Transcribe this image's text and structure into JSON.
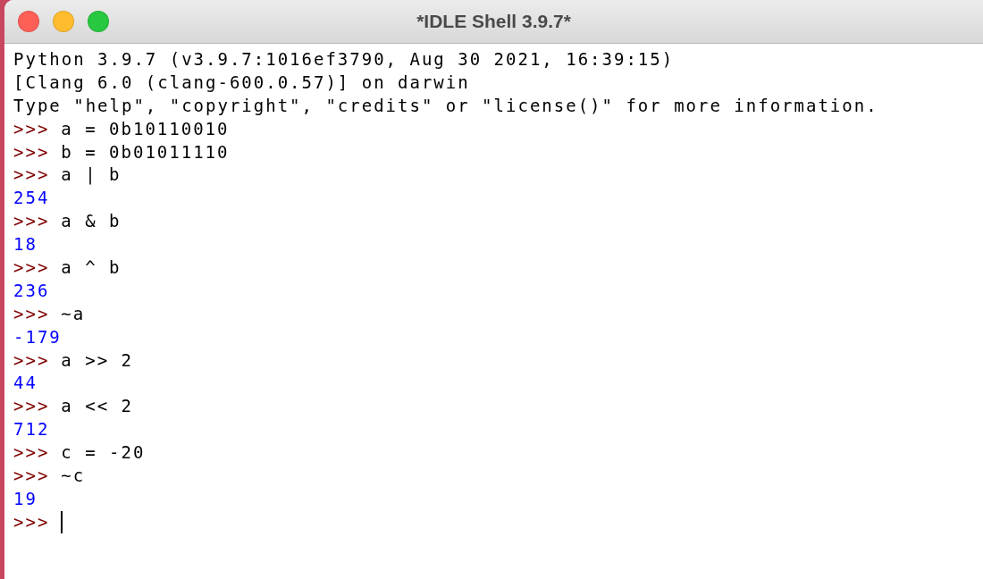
{
  "window": {
    "title": "*IDLE Shell 3.9.7*"
  },
  "shell": {
    "lines": [
      {
        "kind": "banner",
        "text": "Python 3.9.7 (v3.9.7:1016ef3790, Aug 30 2021, 16:39:15)"
      },
      {
        "kind": "banner",
        "text": "[Clang 6.0 (clang-600.0.57)] on darwin"
      },
      {
        "kind": "banner",
        "text": "Type \"help\", \"copyright\", \"credits\" or \"license()\" for more information."
      },
      {
        "kind": "input",
        "prompt": ">>>",
        "code": "a = 0b10110010"
      },
      {
        "kind": "input",
        "prompt": ">>>",
        "code": "b = 0b01011110"
      },
      {
        "kind": "input",
        "prompt": ">>>",
        "code": "a | b"
      },
      {
        "kind": "output",
        "text": "254"
      },
      {
        "kind": "input",
        "prompt": ">>>",
        "code": "a & b"
      },
      {
        "kind": "output",
        "text": "18"
      },
      {
        "kind": "input",
        "prompt": ">>>",
        "code": "a ^ b"
      },
      {
        "kind": "output",
        "text": "236"
      },
      {
        "kind": "input",
        "prompt": ">>>",
        "code": "~a"
      },
      {
        "kind": "output",
        "text": "-179"
      },
      {
        "kind": "input",
        "prompt": ">>>",
        "code": "a >> 2"
      },
      {
        "kind": "output",
        "text": "44"
      },
      {
        "kind": "input",
        "prompt": ">>>",
        "code": "a << 2"
      },
      {
        "kind": "output",
        "text": "712"
      },
      {
        "kind": "input",
        "prompt": ">>>",
        "code": "c = -20"
      },
      {
        "kind": "input",
        "prompt": ">>>",
        "code": "~c"
      },
      {
        "kind": "output",
        "text": "19"
      },
      {
        "kind": "input",
        "prompt": ">>>",
        "cursor": true
      }
    ]
  }
}
